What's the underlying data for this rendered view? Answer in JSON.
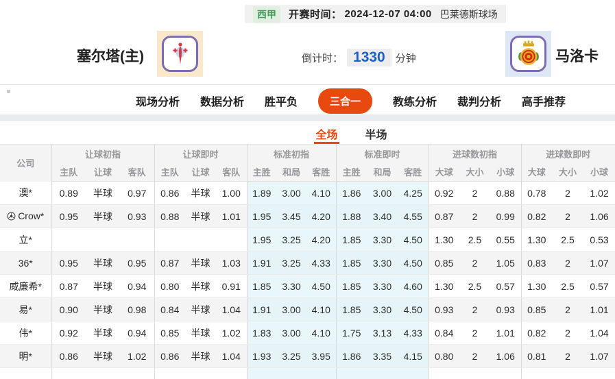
{
  "match_header": {
    "league": "西甲",
    "kickoff_label": "开赛时间：",
    "kickoff_time": "2024-12-07 04:00",
    "venue": "巴莱德斯球场"
  },
  "teams": {
    "home": {
      "name": "塞尔塔(主)",
      "logo_icon": "celta-crest-icon"
    },
    "away": {
      "name": "马洛卡",
      "logo_icon": "mallorca-crest-icon"
    }
  },
  "countdown": {
    "label": "倒计时：",
    "value": "1330",
    "unit": "分钟"
  },
  "nav_tabs": [
    {
      "label": "现场分析",
      "active": false
    },
    {
      "label": "数据分析",
      "active": false
    },
    {
      "label": "胜平负",
      "active": false
    },
    {
      "label": "三合一",
      "active": true
    },
    {
      "label": "教练分析",
      "active": false
    },
    {
      "label": "裁判分析",
      "active": false
    },
    {
      "label": "高手推荐",
      "active": false
    }
  ],
  "sub_tabs": [
    {
      "label": "全场",
      "active": true
    },
    {
      "label": "半场",
      "active": false
    }
  ],
  "odds_table": {
    "company_header": "公司",
    "groups": [
      {
        "label": "让球初指",
        "cols": [
          "主队",
          "让球",
          "客队"
        ],
        "live": false,
        "highlight": false
      },
      {
        "label": "让球即时",
        "cols": [
          "主队",
          "让球",
          "客队"
        ],
        "live": true,
        "highlight": false
      },
      {
        "label": "标准初指",
        "cols": [
          "主胜",
          "和局",
          "客胜"
        ],
        "live": false,
        "highlight": true
      },
      {
        "label": "标准即时",
        "cols": [
          "主胜",
          "和局",
          "客胜"
        ],
        "live": true,
        "highlight": true
      },
      {
        "label": "进球数初指",
        "cols": [
          "大球",
          "大小",
          "小球"
        ],
        "live": false,
        "highlight": false
      },
      {
        "label": "进球数即时",
        "cols": [
          "大球",
          "大小",
          "小球"
        ],
        "live": true,
        "highlight": false
      }
    ],
    "rows": [
      {
        "company": "澳*",
        "cells": [
          [
            "0.89",
            "半球",
            "0.97"
          ],
          [
            "0.86",
            "半球",
            "1.00"
          ],
          [
            "1.89",
            "3.00",
            "4.10"
          ],
          [
            "1.86",
            "3.00",
            "4.25"
          ],
          [
            "0.92",
            "2",
            "0.88"
          ],
          [
            "0.78",
            "2",
            "1.02"
          ]
        ]
      },
      {
        "company": "Crow*",
        "has_ball_icon": true,
        "cells": [
          [
            "0.95",
            "半球",
            "0.93"
          ],
          [
            "0.88",
            "半球",
            "1.01"
          ],
          [
            "1.95",
            "3.45",
            "4.20"
          ],
          [
            "1.88",
            "3.40",
            "4.55"
          ],
          [
            "0.87",
            "2",
            "0.99"
          ],
          [
            "0.82",
            "2",
            "1.06"
          ]
        ]
      },
      {
        "company": "立*",
        "cells": [
          [
            "",
            "",
            ""
          ],
          [
            "",
            "",
            ""
          ],
          [
            "1.95",
            "3.25",
            "4.20"
          ],
          [
            "1.85",
            "3.30",
            "4.50"
          ],
          [
            "1.30",
            "2.5",
            "0.55"
          ],
          [
            "1.30",
            "2.5",
            "0.53"
          ]
        ]
      },
      {
        "company": "36*",
        "cells": [
          [
            "0.95",
            "半球",
            "0.95"
          ],
          [
            "0.87",
            "半球",
            "1.03"
          ],
          [
            "1.91",
            "3.25",
            "4.33"
          ],
          [
            "1.85",
            "3.30",
            "4.50"
          ],
          [
            "0.85",
            "2",
            "1.05"
          ],
          [
            "0.83",
            "2",
            "1.07"
          ]
        ]
      },
      {
        "company": "威廉希*",
        "cells": [
          [
            "0.87",
            "半球",
            "0.94"
          ],
          [
            "0.80",
            "半球",
            "0.91"
          ],
          [
            "1.85",
            "3.30",
            "4.50"
          ],
          [
            "1.85",
            "3.30",
            "4.60"
          ],
          [
            "1.30",
            "2.5",
            "0.57"
          ],
          [
            "1.30",
            "2.5",
            "0.57"
          ]
        ]
      },
      {
        "company": "易*",
        "cells": [
          [
            "0.90",
            "半球",
            "0.98"
          ],
          [
            "0.84",
            "半球",
            "1.04"
          ],
          [
            "1.91",
            "3.00",
            "4.10"
          ],
          [
            "1.85",
            "3.30",
            "4.50"
          ],
          [
            "0.93",
            "2",
            "0.93"
          ],
          [
            "0.85",
            "2",
            "1.01"
          ]
        ]
      },
      {
        "company": "伟*",
        "cells": [
          [
            "0.92",
            "半球",
            "0.94"
          ],
          [
            "0.85",
            "半球",
            "1.02"
          ],
          [
            "1.83",
            "3.00",
            "4.10"
          ],
          [
            "1.75",
            "3.13",
            "4.33"
          ],
          [
            "0.84",
            "2",
            "1.01"
          ],
          [
            "0.82",
            "2",
            "1.04"
          ]
        ]
      },
      {
        "company": "明*",
        "cells": [
          [
            "0.86",
            "半球",
            "1.02"
          ],
          [
            "0.86",
            "半球",
            "1.04"
          ],
          [
            "1.93",
            "3.25",
            "3.95"
          ],
          [
            "1.86",
            "3.35",
            "4.15"
          ],
          [
            "0.80",
            "2",
            "1.06"
          ],
          [
            "0.81",
            "2",
            "1.07"
          ]
        ]
      }
    ]
  },
  "colors": {
    "accent": "#e8490f",
    "live_blue": "#2c6bc5",
    "hl_bg": "#eaf7fa",
    "league_green": "#3f9e5a",
    "countdown_blue": "#1c5fc7"
  }
}
